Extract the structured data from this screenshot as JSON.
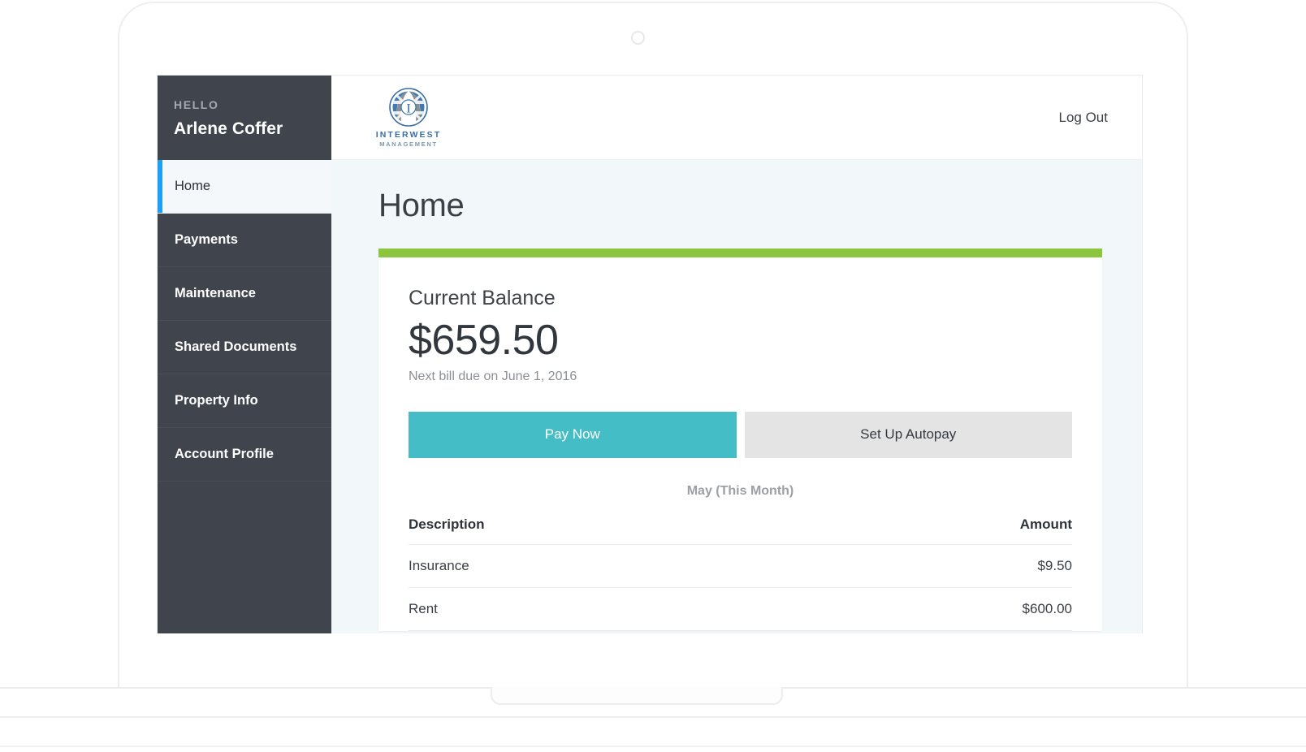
{
  "device": {
    "type": "laptop-mockup",
    "camera_icon": "camera-dot-icon"
  },
  "sidebar": {
    "greeting_label": "HELLO",
    "user_name": "Arlene Coffer",
    "items": [
      {
        "label": "Home",
        "active": true
      },
      {
        "label": "Payments",
        "active": false
      },
      {
        "label": "Maintenance",
        "active": false
      },
      {
        "label": "Shared Documents",
        "active": false
      },
      {
        "label": "Property Info",
        "active": false
      },
      {
        "label": "Account Profile",
        "active": false
      }
    ],
    "background_color": "#40454D",
    "active_accent_color": "#1E9FF2",
    "active_background_color": "#F4F8FA"
  },
  "topbar": {
    "logo_icon": "interwest-globe-logo-icon",
    "logo_line1": "INTERWEST",
    "logo_line2": "MANAGEMENT",
    "logout_label": "Log Out"
  },
  "page": {
    "title": "Home",
    "background_color": "#F2F7F9"
  },
  "balance_card": {
    "accent_bar_color": "#8CC63E",
    "label": "Current Balance",
    "amount": "$659.50",
    "due_note": "Next bill due on June 1, 2016",
    "primary_button": {
      "label": "Pay Now",
      "color": "#45BDC6",
      "text_color": "#FFFFFF"
    },
    "secondary_button": {
      "label": "Set Up Autopay",
      "color": "#E4E4E4",
      "text_color": "#343A40"
    }
  },
  "statement": {
    "month_label": "May (This Month)",
    "columns": [
      "Description",
      "Amount"
    ],
    "rows": [
      {
        "description": "Insurance",
        "amount": "$9.50"
      },
      {
        "description": "Rent",
        "amount": "$600.00"
      }
    ]
  }
}
